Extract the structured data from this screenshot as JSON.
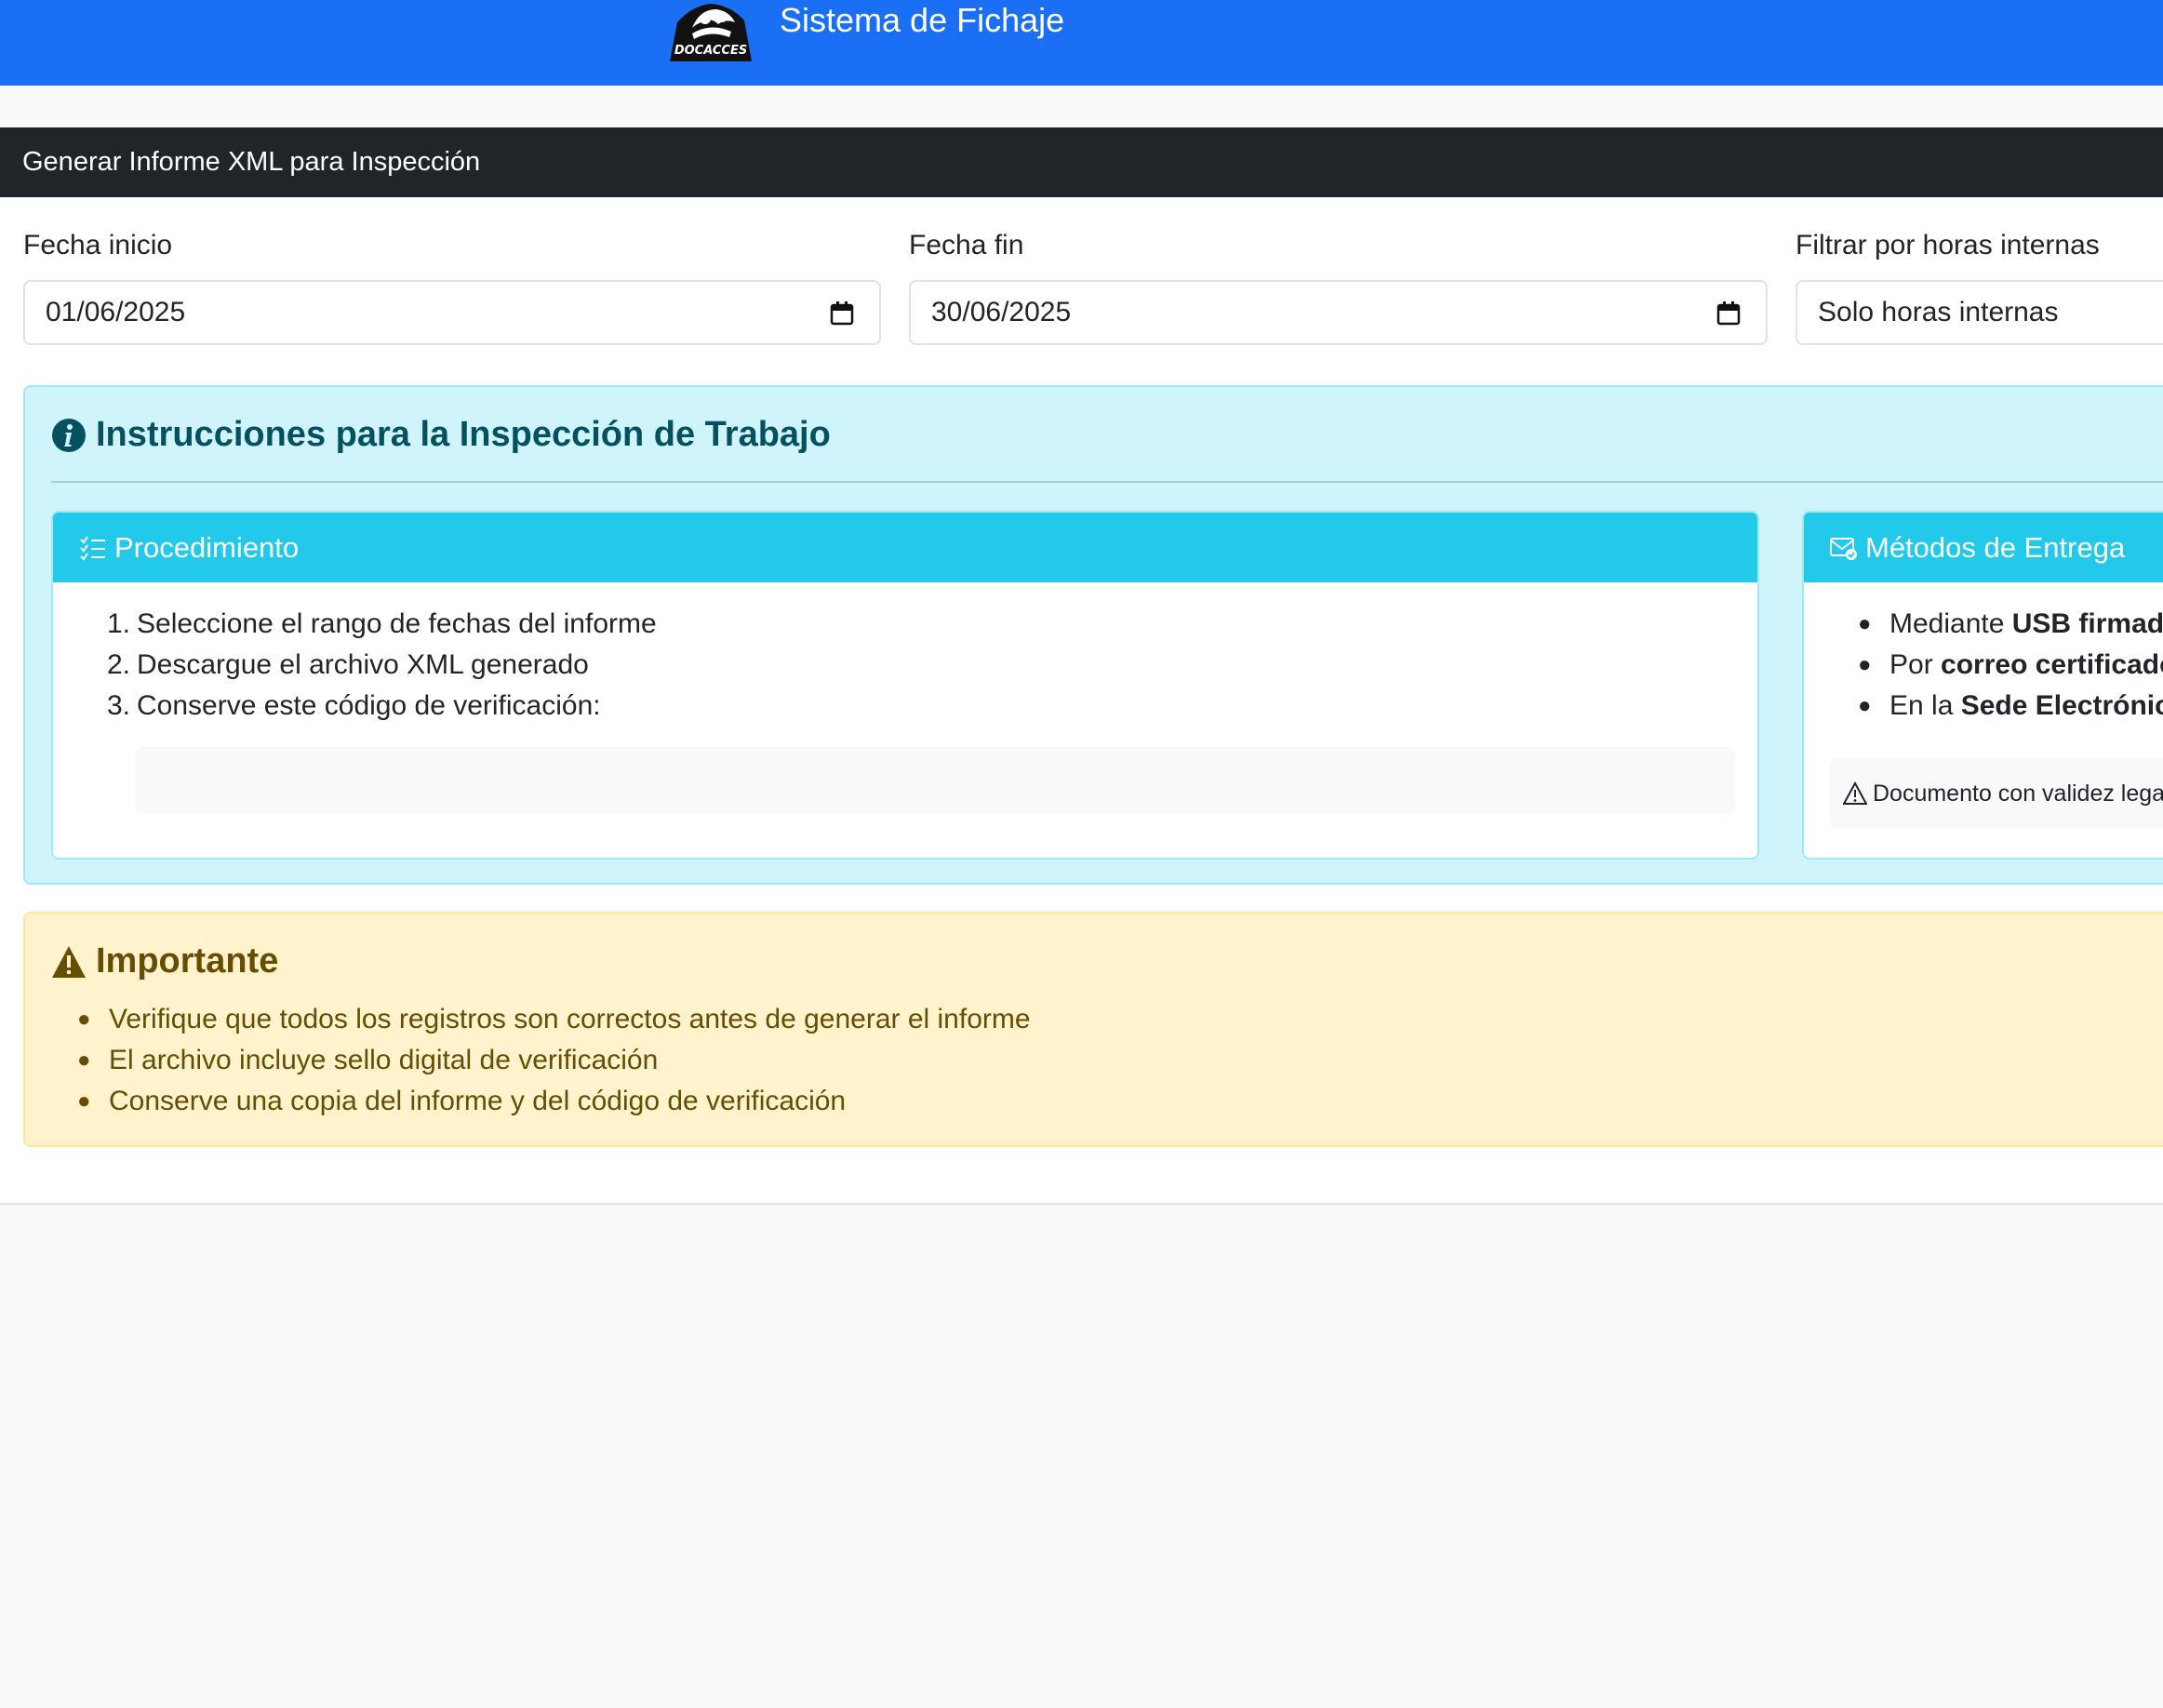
{
  "navbar": {
    "logo_text": "DOCACCES",
    "title": "Sistema de Fichaje"
  },
  "card": {
    "header": "Generar Informe XML para Inspección"
  },
  "form": {
    "start_label": "Fecha inicio",
    "start_value": "01/06/2025",
    "end_label": "Fecha fin",
    "end_value": "30/06/2025",
    "filter_label": "Filtrar por horas internas",
    "filter_value": "Solo horas internas"
  },
  "instructions": {
    "title": "Instrucciones para la Inspección de Trabajo",
    "procedure": {
      "header": "Procedimiento",
      "steps": [
        {
          "num": "1.",
          "text": "Seleccione el rango de fechas del informe"
        },
        {
          "num": "2.",
          "text": "Descargue el archivo XML generado"
        },
        {
          "num": "3.",
          "text": "Conserve este código de verificación:"
        }
      ],
      "verification_code": ""
    },
    "delivery": {
      "header": "Métodos de Entrega",
      "items": [
        {
          "prefix": "Mediante ",
          "bold": "USB firmado"
        },
        {
          "prefix": "Por ",
          "bold": "correo certificado"
        },
        {
          "prefix": "En la ",
          "bold": "Sede Electrónica"
        }
      ],
      "note": "Documento con validez legal"
    }
  },
  "important": {
    "title": "Importante",
    "items": [
      "Verifique que todos los registros son correctos antes de generar el informe",
      "El archivo incluye sello digital de verificación",
      "Conserve una copia del informe y del código de verificación"
    ]
  },
  "colors": {
    "navbar": "#1a6ff5",
    "card_header": "#212529",
    "info_bg": "#cff4fc",
    "info_head": "#22c9eb",
    "warning_bg": "#fff3cd"
  }
}
